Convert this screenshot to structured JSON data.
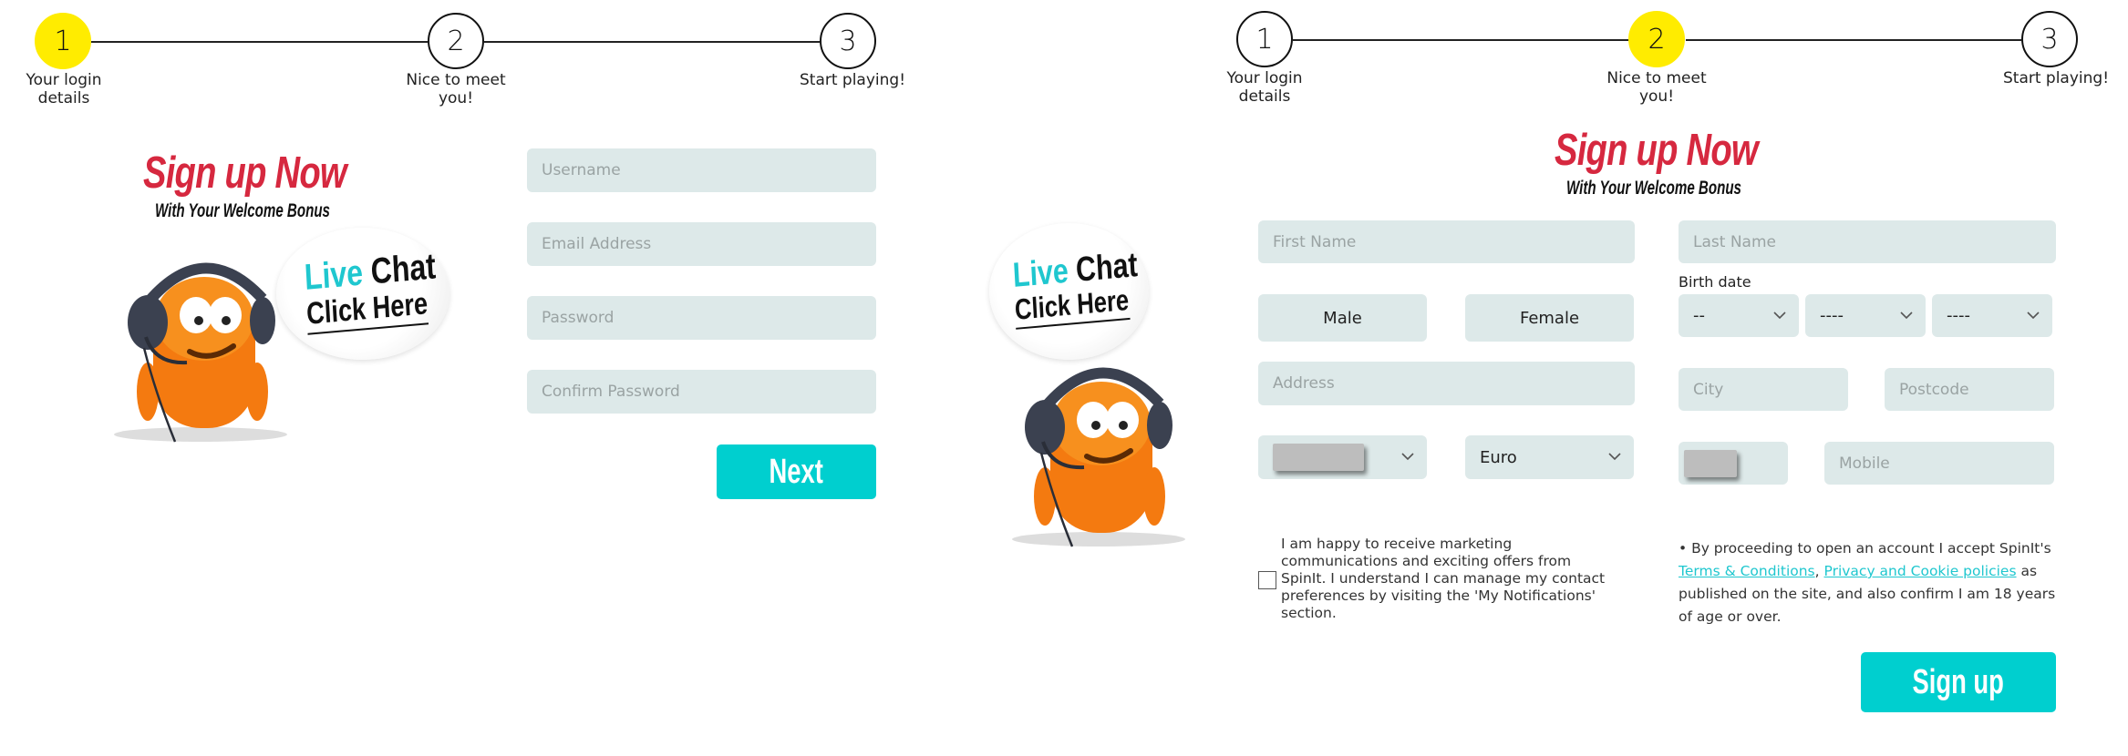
{
  "colors": {
    "accent_yellow": "#ffec00",
    "teal_button": "#00cfcf",
    "input_bg": "#dde9e9",
    "promo_red": "#d6283f",
    "link_teal": "#1fc7cf"
  },
  "steps": [
    {
      "number": "1",
      "label": "Your login details"
    },
    {
      "number": "2",
      "label": "Nice to meet you!"
    },
    {
      "number": "3",
      "label": "Start playing!"
    }
  ],
  "promo": {
    "title": "Sign up Now",
    "subtitle": "With Your Welcome Bonus"
  },
  "live_chat": {
    "word1": "Live",
    "word2": "Chat",
    "action": "Click Here",
    "icon": "orange-mascot-with-headset"
  },
  "screen1": {
    "active_step": 1,
    "fields": {
      "username": {
        "placeholder": "Username",
        "value": ""
      },
      "email": {
        "placeholder": "Email Address",
        "value": ""
      },
      "password": {
        "placeholder": "Password",
        "value": ""
      },
      "confirm_password": {
        "placeholder": "Confirm Password",
        "value": ""
      }
    },
    "next_label": "Next"
  },
  "screen2": {
    "active_step": 2,
    "fields": {
      "first_name": {
        "placeholder": "First Name",
        "value": ""
      },
      "last_name": {
        "placeholder": "Last Name",
        "value": ""
      },
      "address": {
        "placeholder": "Address",
        "value": ""
      },
      "city": {
        "placeholder": "City",
        "value": ""
      },
      "postcode": {
        "placeholder": "Postcode",
        "value": ""
      },
      "mobile": {
        "placeholder": "Mobile",
        "value": ""
      }
    },
    "gender": {
      "male": "Male",
      "female": "Female"
    },
    "birth_date": {
      "label": "Birth date",
      "day": "--",
      "month": "----",
      "year": "----"
    },
    "country": {
      "value": "[redacted]"
    },
    "currency": {
      "value": "Euro"
    },
    "phone_prefix": {
      "value": "[redacted]"
    },
    "marketing_consent": {
      "checked": false,
      "text": "I am happy to receive marketing communications and exciting offers from SpinIt. I understand I can manage my contact preferences by visiting the 'My Notifications' section."
    },
    "terms": {
      "prefix": "• By proceeding to open an account I accept SpinIt's ",
      "terms_link": "Terms & Conditions",
      "separator": ", ",
      "privacy_link": "Privacy and Cookie policies",
      "suffix": " as published on the site, and also confirm I am 18 years of age or over."
    },
    "signup_label": "Sign up"
  }
}
